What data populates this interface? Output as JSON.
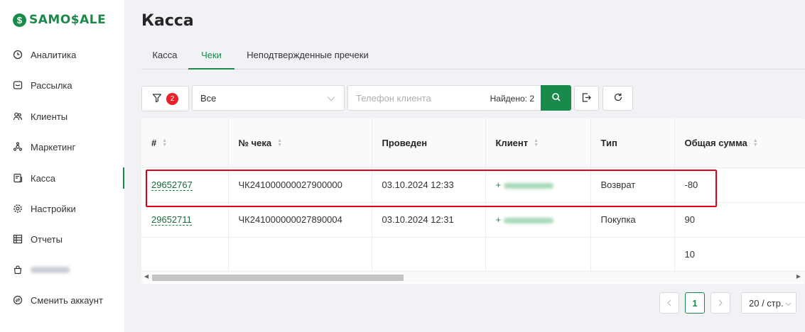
{
  "brand": {
    "logo_symbol": "$",
    "name": "SAMO$ALE",
    "color": "#1a8a4a"
  },
  "sidebar": {
    "items": [
      {
        "label": "Аналитика",
        "icon": "clock-icon"
      },
      {
        "label": "Рассылка",
        "icon": "mail-icon"
      },
      {
        "label": "Клиенты",
        "icon": "users-icon"
      },
      {
        "label": "Маркетинг",
        "icon": "gift-icon"
      },
      {
        "label": "Касса",
        "icon": "register-icon",
        "active": true
      },
      {
        "label": "Настройки",
        "icon": "gear-icon"
      },
      {
        "label": "Отчеты",
        "icon": "table-icon"
      },
      {
        "label": "",
        "icon": "store-icon",
        "redacted": true
      },
      {
        "label": "Сменить аккаунт",
        "icon": "switch-account-icon"
      }
    ]
  },
  "page": {
    "title": "Касса"
  },
  "tabs": [
    {
      "label": "Касса"
    },
    {
      "label": "Чеки",
      "active": true
    },
    {
      "label": "Неподтвержденные пречеки"
    }
  ],
  "toolbar": {
    "filter_count": "2",
    "type_select": {
      "value": "Все"
    },
    "search": {
      "placeholder": "Телефон клиента",
      "value": ""
    },
    "found_label": "Найдено: 2"
  },
  "table": {
    "columns": [
      "#",
      "№ чека",
      "Проведен",
      "Клиент",
      "Тип",
      "Общая сумма"
    ],
    "rows": [
      {
        "id": "29652767",
        "receipt": "ЧК241000000027900000",
        "date": "03.10.2024 12:33",
        "client_prefix": "+",
        "type": "Возврат",
        "total": "-80"
      },
      {
        "id": "29652711",
        "receipt": "ЧК241000000027890004",
        "date": "03.10.2024 12:31",
        "client_prefix": "+",
        "type": "Покупка",
        "total": "90"
      }
    ],
    "summary": {
      "total": "10"
    }
  },
  "pagination": {
    "current": "1",
    "page_size": "20 / стр."
  },
  "colors": {
    "accent": "#1a8a4a",
    "highlight": "#d9001b",
    "badge": "#e8212b"
  }
}
